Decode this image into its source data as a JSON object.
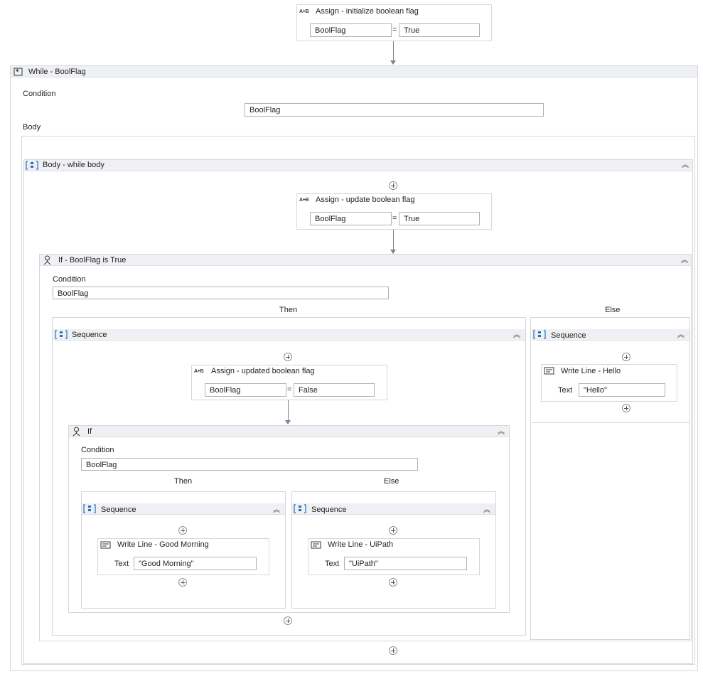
{
  "assign_init": {
    "title": "Assign - initialize boolean flag",
    "to": "BoolFlag",
    "eq": "=",
    "value": "True",
    "icon": "A+B"
  },
  "while": {
    "title": "While - BoolFlag",
    "condition_label": "Condition",
    "condition_value": "BoolFlag",
    "body_label": "Body",
    "body_seq": {
      "title": "Body - while body",
      "assign_update": {
        "title": "Assign - update boolean flag",
        "to": "BoolFlag",
        "eq": "=",
        "value": "True",
        "icon": "A+B"
      },
      "if_outer": {
        "title": "If - BoolFlag is True",
        "condition_label": "Condition",
        "condition_value": "BoolFlag",
        "then_label": "Then",
        "else_label": "Else",
        "then_seq": {
          "title": "Sequence",
          "assign_updated": {
            "title": "Assign - updated boolean flag",
            "to": "BoolFlag",
            "eq": "=",
            "value": "False",
            "icon": "A+B"
          },
          "if_inner": {
            "title": "If",
            "condition_label": "Condition",
            "condition_value": "BoolFlag",
            "then_label": "Then",
            "else_label": "Else",
            "then_seq": {
              "title": "Sequence",
              "writeline": {
                "title": "Write Line - Good Morning",
                "text_label": "Text",
                "text_value": "\"Good Morning\""
              }
            },
            "else_seq": {
              "title": "Sequence",
              "writeline": {
                "title": "Write Line - UiPath",
                "text_label": "Text",
                "text_value": "\"UiPath\""
              }
            }
          }
        },
        "else_seq": {
          "title": "Sequence",
          "writeline": {
            "title": "Write Line - Hello",
            "text_label": "Text",
            "text_value": "\"Hello\""
          }
        }
      }
    }
  },
  "icons": {
    "collapse": "chevron-double-up-icon",
    "add": "add-activity-icon",
    "assign": "assign-icon",
    "while": "while-loop-icon",
    "sequence": "sequence-icon",
    "if": "if-icon",
    "writeline": "write-line-icon"
  },
  "colors": {
    "border": "#d4d7dc",
    "header": "#eef0f3",
    "connector": "#7d848b"
  }
}
